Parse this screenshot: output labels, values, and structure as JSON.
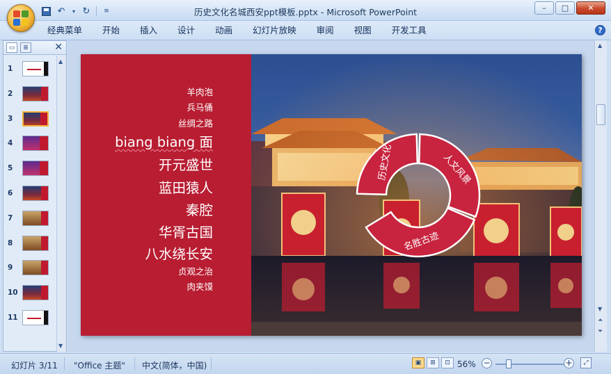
{
  "window": {
    "title": "历史文化名城西安ppt模板.pptx - Microsoft PowerPoint",
    "controls": {
      "minimize": "–",
      "maximize": "□",
      "close": "✕"
    }
  },
  "quick_access": [
    "save-icon",
    "undo-icon",
    "redo-icon",
    "customize-icon"
  ],
  "menu": [
    "经典菜单",
    "开始",
    "插入",
    "设计",
    "动画",
    "幻灯片放映",
    "审阅",
    "视图",
    "开发工具"
  ],
  "thumbnails": {
    "numbers": [
      "1",
      "2",
      "3",
      "4",
      "5",
      "6",
      "7",
      "8",
      "9",
      "10",
      "11"
    ],
    "selected_index": 3,
    "close_label": "✕"
  },
  "slide": {
    "items": [
      "羊肉泡",
      "兵马俑",
      "丝绸之路",
      "biang biang 面",
      "开元盛世",
      "蓝田猿人",
      "秦腔",
      "华胥古国",
      "八水绕长安",
      "贞观之治",
      "肉夹馍"
    ],
    "ring": {
      "segments": [
        "历史文化",
        "人文风景",
        "名胜古迹"
      ],
      "color": "#c8243f"
    },
    "left_color": "#b81d32"
  },
  "status": {
    "slide_info": "幻灯片 3/11",
    "theme": "\"Office 主题\"",
    "language": "中文(简体，中国)",
    "zoom": "56%",
    "zoom_level": 0.56
  }
}
